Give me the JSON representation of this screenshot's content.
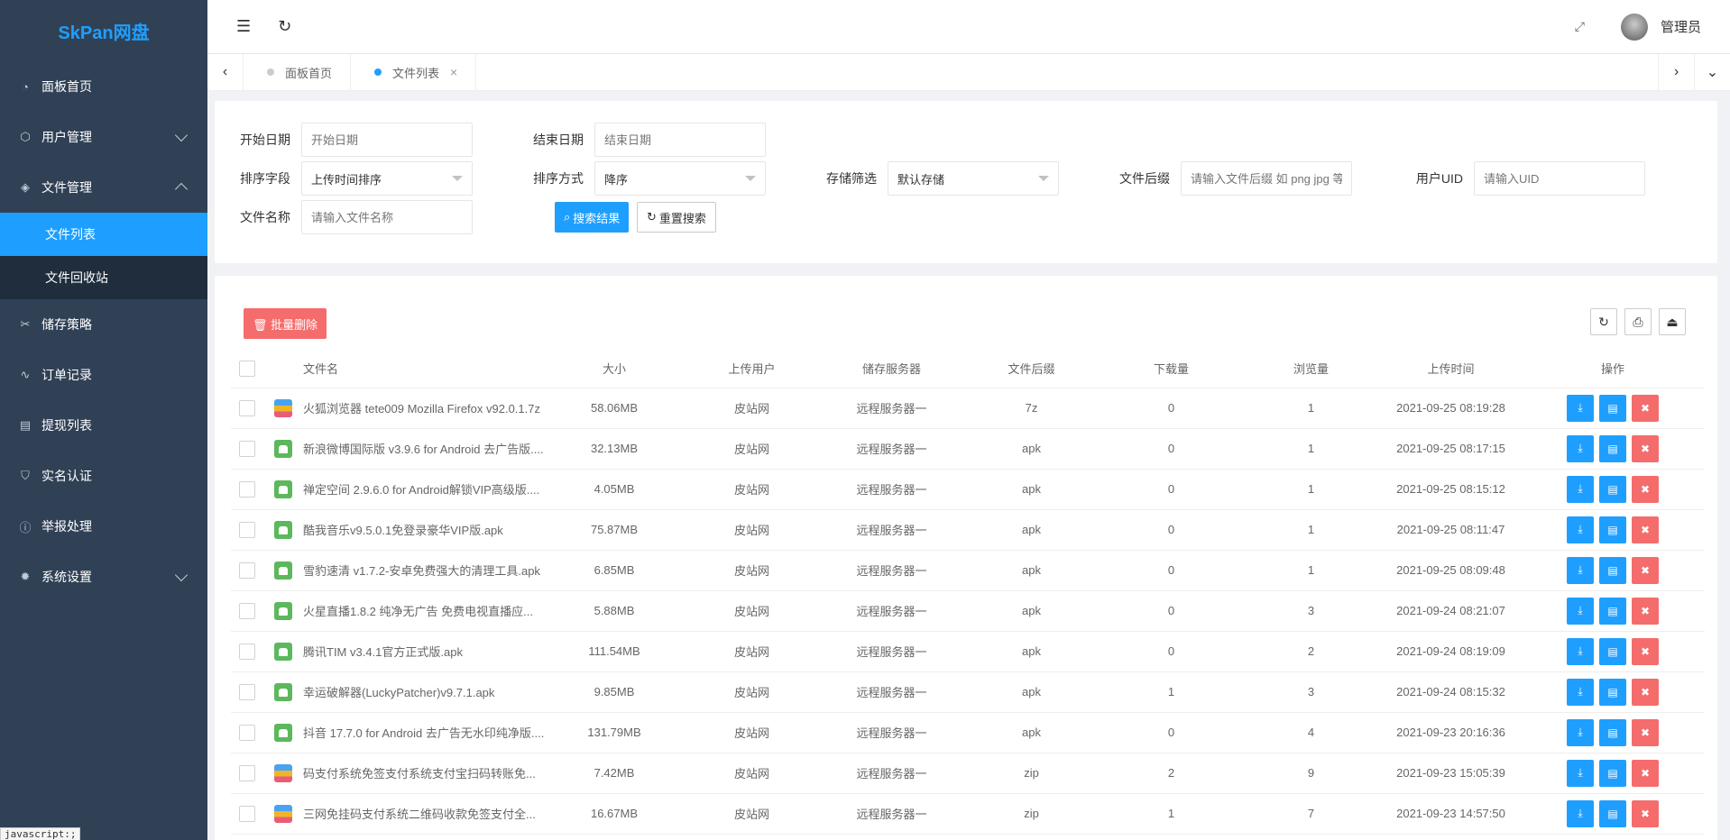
{
  "app": {
    "logo": "SkPan网盘",
    "user_name": "管理员"
  },
  "sidebar": {
    "items": [
      {
        "label": "面板首页",
        "icon": "dashboard-icon",
        "glyph": "◔"
      },
      {
        "label": "用户管理",
        "icon": "cube-icon",
        "glyph": "⬡"
      },
      {
        "label": "文件管理",
        "icon": "layers-icon",
        "glyph": "◈"
      },
      {
        "label": "储存策略",
        "icon": "tools-icon",
        "glyph": "✂"
      },
      {
        "label": "订单记录",
        "icon": "pulse-icon",
        "glyph": "∿"
      },
      {
        "label": "提现列表",
        "icon": "list-icon",
        "glyph": "▤"
      },
      {
        "label": "实名认证",
        "icon": "shield-icon",
        "glyph": "⛉"
      },
      {
        "label": "举报处理",
        "icon": "info-icon",
        "glyph": "ⓘ"
      },
      {
        "label": "系统设置",
        "icon": "gear-icon",
        "glyph": "✹"
      }
    ],
    "sub_items": [
      {
        "label": "文件列表"
      },
      {
        "label": "文件回收站"
      }
    ]
  },
  "tabs": [
    {
      "label": "面板首页"
    },
    {
      "label": "文件列表"
    }
  ],
  "filters": {
    "start_date": {
      "label": "开始日期",
      "placeholder": "开始日期"
    },
    "end_date": {
      "label": "结束日期",
      "placeholder": "结束日期"
    },
    "sort_field": {
      "label": "排序字段",
      "value": "上传时间排序"
    },
    "sort_order": {
      "label": "排序方式",
      "value": "降序"
    },
    "storage": {
      "label": "存储筛选",
      "value": "默认存储"
    },
    "suffix": {
      "label": "文件后缀",
      "placeholder": "请输入文件后缀 如 png jpg 等"
    },
    "uid": {
      "label": "用户UID",
      "placeholder": "请输入UID"
    },
    "name": {
      "label": "文件名称",
      "placeholder": "请输入文件名称"
    },
    "search_label": "搜索结果",
    "reset_label": "重置搜索"
  },
  "toolbar": {
    "batch_delete": "批量删除"
  },
  "table": {
    "headers": [
      "文件名",
      "大小",
      "上传用户",
      "储存服务器",
      "文件后缀",
      "下载量",
      "浏览量",
      "上传时间",
      "操作"
    ],
    "rows": [
      {
        "name": "火狐浏览器 tete009 Mozilla Firefox v92.0.1.7z",
        "size": "58.06MB",
        "user": "皮站网",
        "server": "远程服务器一",
        "ext": "7z",
        "downloads": "0",
        "views": "1",
        "time": "2021-09-25 08:19:28",
        "icon": "archive"
      },
      {
        "name": "新浪微博国际版 v3.9.6 for Android 去广告版....",
        "size": "32.13MB",
        "user": "皮站网",
        "server": "远程服务器一",
        "ext": "apk",
        "downloads": "0",
        "views": "1",
        "time": "2021-09-25 08:17:15",
        "icon": "android"
      },
      {
        "name": "禅定空间 2.9.6.0 for Android解锁VIP高级版....",
        "size": "4.05MB",
        "user": "皮站网",
        "server": "远程服务器一",
        "ext": "apk",
        "downloads": "0",
        "views": "1",
        "time": "2021-09-25 08:15:12",
        "icon": "android"
      },
      {
        "name": "酷我音乐v9.5.0.1免登录豪华VIP版.apk",
        "size": "75.87MB",
        "user": "皮站网",
        "server": "远程服务器一",
        "ext": "apk",
        "downloads": "0",
        "views": "1",
        "time": "2021-09-25 08:11:47",
        "icon": "android"
      },
      {
        "name": "雪豹速清 v1.7.2-安卓免费强大的清理工具.apk",
        "size": "6.85MB",
        "user": "皮站网",
        "server": "远程服务器一",
        "ext": "apk",
        "downloads": "0",
        "views": "1",
        "time": "2021-09-25 08:09:48",
        "icon": "android"
      },
      {
        "name": "火星直播1.8.2 纯净无广告 免费电视直播应...",
        "size": "5.88MB",
        "user": "皮站网",
        "server": "远程服务器一",
        "ext": "apk",
        "downloads": "0",
        "views": "3",
        "time": "2021-09-24 08:21:07",
        "icon": "android"
      },
      {
        "name": "腾讯TIM v3.4.1官方正式版.apk",
        "size": "111.54MB",
        "user": "皮站网",
        "server": "远程服务器一",
        "ext": "apk",
        "downloads": "0",
        "views": "2",
        "time": "2021-09-24 08:19:09",
        "icon": "android"
      },
      {
        "name": "幸运破解器(LuckyPatcher)v9.7.1.apk",
        "size": "9.85MB",
        "user": "皮站网",
        "server": "远程服务器一",
        "ext": "apk",
        "downloads": "1",
        "views": "3",
        "time": "2021-09-24 08:15:32",
        "icon": "android"
      },
      {
        "name": "抖音 17.7.0 for Android 去广告无水印纯净版....",
        "size": "131.79MB",
        "user": "皮站网",
        "server": "远程服务器一",
        "ext": "apk",
        "downloads": "0",
        "views": "4",
        "time": "2021-09-23 20:16:36",
        "icon": "android"
      },
      {
        "name": "码支付系统免签支付系统支付宝扫码转账免...",
        "size": "7.42MB",
        "user": "皮站网",
        "server": "远程服务器一",
        "ext": "zip",
        "downloads": "2",
        "views": "9",
        "time": "2021-09-23 15:05:39",
        "icon": "archive"
      },
      {
        "name": "三网免挂码支付系统二维码收款免签支付全...",
        "size": "16.67MB",
        "user": "皮站网",
        "server": "远程服务器一",
        "ext": "zip",
        "downloads": "1",
        "views": "7",
        "time": "2021-09-23 14:57:50",
        "icon": "archive"
      }
    ]
  },
  "status_bar": "javascript:;"
}
